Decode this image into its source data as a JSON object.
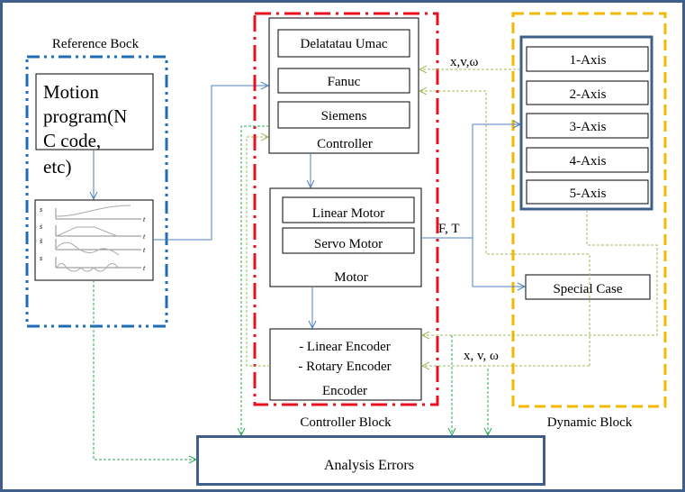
{
  "reference_block": {
    "label": "Reference Bock",
    "motion_program_lines": [
      "Motion",
      "program(N",
      "C code,",
      "etc)"
    ],
    "graph_axes": {
      "y_labels": [
        "s",
        "ṡ",
        "s̈",
        "s⃛"
      ],
      "x_label": "t"
    }
  },
  "controller_block": {
    "label": "Controller Block",
    "controller": {
      "label": "Controller",
      "items": [
        "Delatatau  Umac",
        "Fanuc",
        "Siemens"
      ]
    },
    "motor": {
      "label": "Motor",
      "items": [
        "Linear  Motor",
        "Servo Motor"
      ]
    },
    "encoder": {
      "label": "Encoder",
      "items": [
        "- Linear  Encoder",
        "- Rotary Encoder"
      ]
    }
  },
  "dynamic_block": {
    "label": "Dynamic Block",
    "axes": [
      "1-Axis",
      "2-Axis",
      "3-Axis",
      "4-Axis",
      "5-Axis"
    ],
    "special_case": "Special Case"
  },
  "signals": {
    "feedback_top": "x,v,ω",
    "force_torque": "F, T",
    "feedback_bottom": "x, v, ω"
  },
  "analysis": {
    "label": "Analysis  Errors"
  },
  "colors": {
    "frame": "#3f5f8a",
    "reference": "#1f6bb5",
    "controller": "#e8101c",
    "dynamic": "#f5b800",
    "flow": "#4f81bd",
    "feedback": "#9bbb59",
    "error_path": "#2eaa55"
  }
}
